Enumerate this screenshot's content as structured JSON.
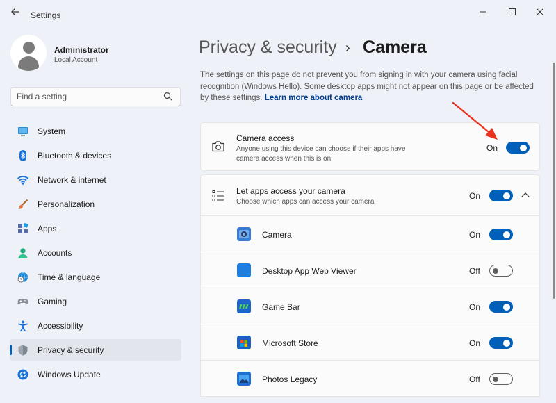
{
  "window": {
    "title": "Settings"
  },
  "user": {
    "name": "Administrator",
    "account_type": "Local Account"
  },
  "search": {
    "placeholder": "Find a setting"
  },
  "nav": [
    {
      "label": "System",
      "icon": "monitor-icon"
    },
    {
      "label": "Bluetooth & devices",
      "icon": "bluetooth-icon"
    },
    {
      "label": "Network & internet",
      "icon": "wifi-icon"
    },
    {
      "label": "Personalization",
      "icon": "brush-icon"
    },
    {
      "label": "Apps",
      "icon": "apps-icon"
    },
    {
      "label": "Accounts",
      "icon": "person-icon"
    },
    {
      "label": "Time & language",
      "icon": "globe-clock-icon"
    },
    {
      "label": "Gaming",
      "icon": "gamepad-icon"
    },
    {
      "label": "Accessibility",
      "icon": "accessibility-icon"
    },
    {
      "label": "Privacy & security",
      "icon": "shield-icon",
      "active": true
    },
    {
      "label": "Windows Update",
      "icon": "refresh-icon"
    }
  ],
  "breadcrumb": {
    "parent": "Privacy & security",
    "separator": "›",
    "current": "Camera"
  },
  "description": {
    "text": "The settings on this page do not prevent you from signing in with your camera using facial recognition (Windows Hello). Some desktop apps might not appear on this page or be affected by these settings.",
    "link": "Learn more about camera"
  },
  "camera_access": {
    "title": "Camera access",
    "subtitle_line1": "Anyone using this device can choose if their apps have",
    "subtitle_line2": "camera access when this is on",
    "state": "On"
  },
  "apps_access": {
    "title": "Let apps access your camera",
    "subtitle": "Choose which apps can access your camera",
    "state": "On"
  },
  "apps": [
    {
      "name": "Camera",
      "state": "On",
      "icon": "camera-app-icon"
    },
    {
      "name": "Desktop App Web Viewer",
      "state": "Off",
      "icon": "web-viewer-app-icon"
    },
    {
      "name": "Game Bar",
      "state": "On",
      "icon": "game-bar-app-icon"
    },
    {
      "name": "Microsoft Store",
      "state": "On",
      "icon": "store-app-icon"
    },
    {
      "name": "Photos Legacy",
      "state": "Off",
      "icon": "photos-app-icon"
    }
  ],
  "colors": {
    "accent": "#005fb8",
    "annotation_arrow": "#e8321c",
    "link": "#003e92"
  }
}
